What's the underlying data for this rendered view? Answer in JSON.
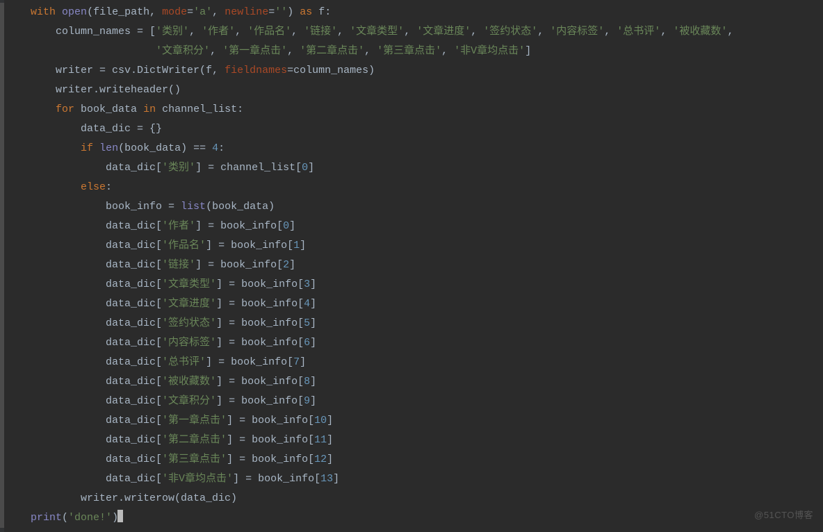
{
  "watermark": "@51CTO博客",
  "indent_unit": "    ",
  "code": {
    "l1": [
      [
        "    ",
        "def"
      ],
      [
        "with",
        "kw"
      ],
      [
        " ",
        "def"
      ],
      [
        "open",
        "bi"
      ],
      [
        "(file_path",
        ""
      ],
      [
        ",",
        "punct"
      ],
      [
        " ",
        "def"
      ],
      [
        "mode",
        "kwarg"
      ],
      [
        "=",
        "op"
      ],
      [
        "'a'",
        "str"
      ],
      [
        ",",
        "punct"
      ],
      [
        " ",
        "def"
      ],
      [
        "newline",
        "kwarg"
      ],
      [
        "=",
        "op"
      ],
      [
        "''",
        "str"
      ],
      [
        ") ",
        "def"
      ],
      [
        "as",
        "kw"
      ],
      [
        " f:",
        "def"
      ]
    ],
    "l2": [
      [
        "        column_names = [",
        "def"
      ],
      [
        "'类别'",
        "str"
      ],
      [
        ", ",
        "def"
      ],
      [
        "'作者'",
        "str"
      ],
      [
        ", ",
        "def"
      ],
      [
        "'作品名'",
        "str"
      ],
      [
        ", ",
        "def"
      ],
      [
        "'链接'",
        "str"
      ],
      [
        ", ",
        "def"
      ],
      [
        "'文章类型'",
        "str"
      ],
      [
        ", ",
        "def"
      ],
      [
        "'文章进度'",
        "str"
      ],
      [
        ", ",
        "def"
      ],
      [
        "'签约状态'",
        "str"
      ],
      [
        ", ",
        "def"
      ],
      [
        "'内容标签'",
        "str"
      ],
      [
        ", ",
        "def"
      ],
      [
        "'总书评'",
        "str"
      ],
      [
        ", ",
        "def"
      ],
      [
        "'被收藏数'",
        "str"
      ],
      [
        ",",
        "def"
      ]
    ],
    "l3": [
      [
        "                        ",
        "def"
      ],
      [
        "'文章积分'",
        "str"
      ],
      [
        ", ",
        "def"
      ],
      [
        "'第一章点击'",
        "str"
      ],
      [
        ", ",
        "def"
      ],
      [
        "'第二章点击'",
        "str"
      ],
      [
        ", ",
        "def"
      ],
      [
        "'第三章点击'",
        "str"
      ],
      [
        ", ",
        "def"
      ],
      [
        "'非V章均点击'",
        "str"
      ],
      [
        "]",
        "def"
      ]
    ],
    "l4": [
      [
        "        writer = csv.DictWriter(f",
        ""
      ],
      [
        ",",
        "punct"
      ],
      [
        " ",
        "def"
      ],
      [
        "fieldnames",
        "kwarg"
      ],
      [
        "=column_names)",
        "def"
      ]
    ],
    "l5": [
      [
        "        writer.writeheader()",
        "def"
      ]
    ],
    "l6": [
      [
        "        ",
        "def"
      ],
      [
        "for",
        "kw"
      ],
      [
        " book_data ",
        "def"
      ],
      [
        "in",
        "kw"
      ],
      [
        " channel_list:",
        "def"
      ]
    ],
    "l7": [
      [
        "            data_dic = {}",
        "def"
      ]
    ],
    "l8": [
      [
        "            ",
        "def"
      ],
      [
        "if",
        "kw"
      ],
      [
        " ",
        "def"
      ],
      [
        "len",
        "bi"
      ],
      [
        "(book_data) == ",
        "def"
      ],
      [
        "4",
        "num"
      ],
      [
        ":",
        "def"
      ]
    ],
    "l9": [
      [
        "                data_dic[",
        "def"
      ],
      [
        "'类别'",
        "str"
      ],
      [
        "] = channel_list[",
        "def"
      ],
      [
        "0",
        "num"
      ],
      [
        "]",
        "def"
      ]
    ],
    "l10": [
      [
        "            ",
        "def"
      ],
      [
        "else",
        "kw"
      ],
      [
        ":",
        "def"
      ]
    ],
    "l11": [
      [
        "                book_info = ",
        "def"
      ],
      [
        "list",
        "bi"
      ],
      [
        "(book_data)",
        "def"
      ]
    ],
    "l12": [
      [
        "                data_dic[",
        "def"
      ],
      [
        "'作者'",
        "str"
      ],
      [
        "] = book_info[",
        "def"
      ],
      [
        "0",
        "num"
      ],
      [
        "]",
        "def"
      ]
    ],
    "l13": [
      [
        "                data_dic[",
        "def"
      ],
      [
        "'作品名'",
        "str"
      ],
      [
        "] = book_info[",
        "def"
      ],
      [
        "1",
        "num"
      ],
      [
        "]",
        "def"
      ]
    ],
    "l14": [
      [
        "                data_dic[",
        "def"
      ],
      [
        "'链接'",
        "str"
      ],
      [
        "] = book_info[",
        "def"
      ],
      [
        "2",
        "num"
      ],
      [
        "]",
        "def"
      ]
    ],
    "l15": [
      [
        "                data_dic[",
        "def"
      ],
      [
        "'文章类型'",
        "str"
      ],
      [
        "] = book_info[",
        "def"
      ],
      [
        "3",
        "num"
      ],
      [
        "]",
        "def"
      ]
    ],
    "l16": [
      [
        "                data_dic[",
        "def"
      ],
      [
        "'文章进度'",
        "str"
      ],
      [
        "] = book_info[",
        "def"
      ],
      [
        "4",
        "num"
      ],
      [
        "]",
        "def"
      ]
    ],
    "l17": [
      [
        "                data_dic[",
        "def"
      ],
      [
        "'签约状态'",
        "str"
      ],
      [
        "] = book_info[",
        "def"
      ],
      [
        "5",
        "num"
      ],
      [
        "]",
        "def"
      ]
    ],
    "l18": [
      [
        "                data_dic[",
        "def"
      ],
      [
        "'内容标签'",
        "str"
      ],
      [
        "] = book_info[",
        "def"
      ],
      [
        "6",
        "num"
      ],
      [
        "]",
        "def"
      ]
    ],
    "l19": [
      [
        "                data_dic[",
        "def"
      ],
      [
        "'总书评'",
        "str"
      ],
      [
        "] = book_info[",
        "def"
      ],
      [
        "7",
        "num"
      ],
      [
        "]",
        "def"
      ]
    ],
    "l20": [
      [
        "                data_dic[",
        "def"
      ],
      [
        "'被收藏数'",
        "str"
      ],
      [
        "] = book_info[",
        "def"
      ],
      [
        "8",
        "num"
      ],
      [
        "]",
        "def"
      ]
    ],
    "l21": [
      [
        "                data_dic[",
        "def"
      ],
      [
        "'文章积分'",
        "str"
      ],
      [
        "] = book_info[",
        "def"
      ],
      [
        "9",
        "num"
      ],
      [
        "]",
        "def"
      ]
    ],
    "l22": [
      [
        "                data_dic[",
        "def"
      ],
      [
        "'第一章点击'",
        "str"
      ],
      [
        "] = book_info[",
        "def"
      ],
      [
        "10",
        "num"
      ],
      [
        "]",
        "def"
      ]
    ],
    "l23": [
      [
        "                data_dic[",
        "def"
      ],
      [
        "'第二章点击'",
        "str"
      ],
      [
        "] = book_info[",
        "def"
      ],
      [
        "11",
        "num"
      ],
      [
        "]",
        "def"
      ]
    ],
    "l24": [
      [
        "                data_dic[",
        "def"
      ],
      [
        "'第三章点击'",
        "str"
      ],
      [
        "] = book_info[",
        "def"
      ],
      [
        "12",
        "num"
      ],
      [
        "]",
        "def"
      ]
    ],
    "l25": [
      [
        "                data_dic[",
        "def"
      ],
      [
        "'非V章均点击'",
        "str"
      ],
      [
        "] = book_info[",
        "def"
      ],
      [
        "13",
        "num"
      ],
      [
        "]",
        "def"
      ]
    ],
    "l26": [
      [
        "            writer.writerow(data_dic)",
        "def"
      ]
    ],
    "l27": [
      [
        "    ",
        "def"
      ],
      [
        "print",
        "bi"
      ],
      [
        "(",
        "def"
      ],
      [
        "'done!'",
        "str"
      ],
      [
        ")",
        "def"
      ]
    ]
  },
  "column_names": [
    "类别",
    "作者",
    "作品名",
    "链接",
    "文章类型",
    "文章进度",
    "签约状态",
    "内容标签",
    "总书评",
    "被收藏数",
    "文章积分",
    "第一章点击",
    "第二章点击",
    "第三章点击",
    "非V章均点击"
  ],
  "cursor_line": 27
}
